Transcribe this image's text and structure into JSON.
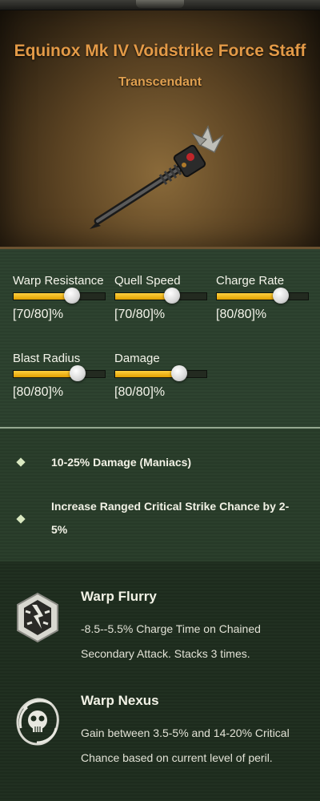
{
  "item": {
    "name": "Equinox Mk IV Voidstrike Force Staff",
    "rarity": "Transcendant",
    "icon": "force-staff-image"
  },
  "stats": [
    {
      "label": "Warp Resistance",
      "value": "[70/80]%",
      "level": 0.64
    },
    {
      "label": "Quell Speed",
      "value": "[70/80]%",
      "level": 0.62
    },
    {
      "label": "Charge Rate",
      "value": "[80/80]%",
      "level": 0.7
    },
    {
      "label": "Blast Radius",
      "value": "[80/80]%",
      "level": 0.7
    },
    {
      "label": "Damage",
      "value": "[80/80]%",
      "level": 0.7
    }
  ],
  "perks": [
    {
      "text": "10-25% Damage (Maniacs)",
      "icon": "diamond-bullet-icon"
    },
    {
      "text": "Increase Ranged Critical Strike Chance by 2-5%",
      "icon": "diamond-bullet-icon"
    }
  ],
  "talents": [
    {
      "name": "Warp Flurry",
      "description": "-8.5--5.5% Charge Time on Chained Secondary Attack. Stacks 3 times.",
      "icon": "warp-flurry-icon"
    },
    {
      "name": "Warp Nexus",
      "description": "Gain between 3.5-5% and 14-20% Critical Chance based on current level of peril.",
      "icon": "warp-nexus-icon"
    }
  ],
  "colors": {
    "title": "#e39a47",
    "accent_bar": "#f0b800",
    "panel": "#2e4330"
  }
}
